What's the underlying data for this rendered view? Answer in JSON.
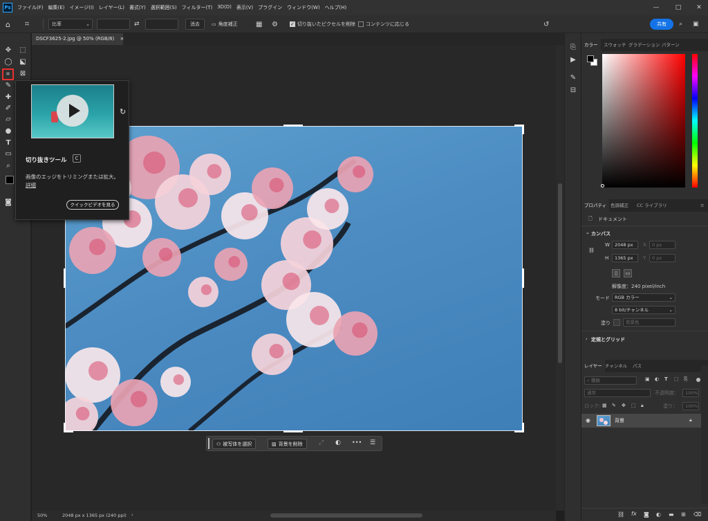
{
  "app": {
    "logo": "Ps"
  },
  "menu": [
    "ファイル(F)",
    "編集(E)",
    "イメージ(I)",
    "レイヤー(L)",
    "書式(Y)",
    "選択範囲(S)",
    "フィルター(T)",
    "3D(D)",
    "表示(V)",
    "プラグイン",
    "ウィンドウ(W)",
    "ヘルプ(H)"
  ],
  "window_controls": {
    "minimize": "—",
    "maximize": "□",
    "close": "✕"
  },
  "options": {
    "ratio_label": "比率",
    "swap_icon": "⇄",
    "clear_label": "消去",
    "straighten_label": "角度補正",
    "delete_cropped_label": "切り抜いたピクセルを削除",
    "delete_cropped_checked": true,
    "content_aware_label": "コンテンツに応じる",
    "content_aware_checked": false,
    "share_label": "共有"
  },
  "document": {
    "tab_title": "DSCF3625-2.jpg @ 50% (RGB/8)",
    "tab_close": "×"
  },
  "tooltip": {
    "title": "切り抜きツール",
    "shortcut": "C",
    "description": "画像のエッジをトリミングまたは拡大。",
    "details_link": "詳細",
    "video_button": "クイックビデオを見る"
  },
  "context_bar": {
    "select_subject": "被写体を選択",
    "remove_background": "背景を削除",
    "more": "•••"
  },
  "status": {
    "zoom": "50%",
    "dimensions": "2048 px x 1365 px (240 ppi)",
    "arrow": "›"
  },
  "color_panel": {
    "tabs": [
      "カラー",
      "スウォッチ",
      "グラデーション",
      "パターン"
    ],
    "active_tab": 0,
    "fg": "#000000",
    "bg": "#ffffff",
    "hue": "#ff0000"
  },
  "properties_panel": {
    "tabs": [
      "プロパティ",
      "色調補正",
      "CC ライブラリ"
    ],
    "active_tab": 0,
    "doc_label": "ドキュメント",
    "canvas_section": "カンバス",
    "w_label": "W",
    "w_value": "2048 px",
    "x_label": "X",
    "x_value": "0 px",
    "h_label": "H",
    "h_value": "1365 px",
    "y_label": "Y",
    "y_value": "0 px",
    "resolution": "解像度：240 pixel/inch",
    "mode_label": "モード",
    "mode_value": "RGB カラー",
    "bits_value": "8 bit/チャンネル",
    "fill_label": "塗り",
    "fill_value": "背景色",
    "rulers_section": "定規とグリッド"
  },
  "layers_panel": {
    "tabs": [
      "レイヤー",
      "チャンネル",
      "パス"
    ],
    "active_tab": 0,
    "kind_label": "種類",
    "blend_mode": "通常",
    "opacity_label": "不透明度：",
    "opacity_value": "100%",
    "lock_label": "ロック：",
    "fill_label": "塗り：",
    "fill_value": "100%",
    "layer_name": "背景"
  },
  "colors": {
    "accent": "#1473e6",
    "tool_highlight": "#e8322f"
  }
}
